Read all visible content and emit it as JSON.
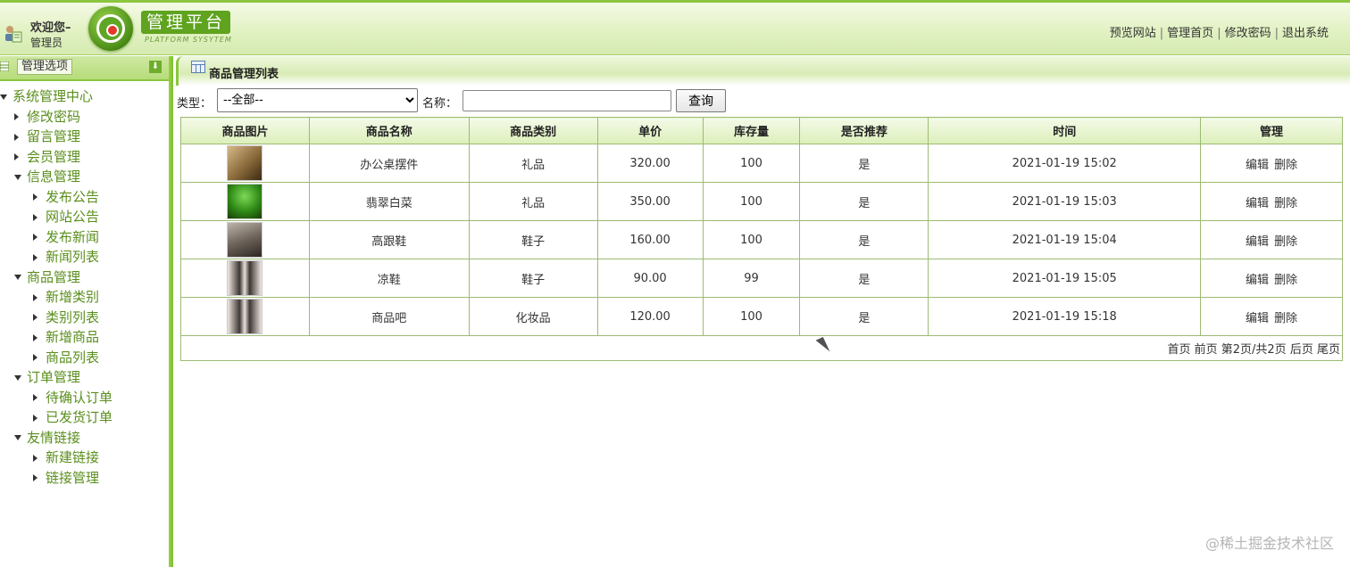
{
  "header": {
    "welcome": "欢迎您–",
    "role": "管理员",
    "logo_title": "管理平台",
    "logo_sub": "PLATFORM SYSYTEM",
    "links": [
      "预览网站",
      "管理首页",
      "修改密码",
      "退出系统"
    ],
    "accent": "#8cc63f"
  },
  "sidebar": {
    "title": "管理选项",
    "tree": [
      {
        "label": "系统管理中心",
        "level": 0,
        "icon": "triangle-down-icon"
      },
      {
        "label": "修改密码",
        "level": 1,
        "icon": "triangle-right-icon"
      },
      {
        "label": "留言管理",
        "level": 1,
        "icon": "triangle-right-icon"
      },
      {
        "label": "会员管理",
        "level": 1,
        "icon": "triangle-right-icon"
      },
      {
        "label": "信息管理",
        "level": 1,
        "icon": "triangle-down-icon"
      },
      {
        "label": "发布公告",
        "level": 2,
        "icon": "triangle-right-icon"
      },
      {
        "label": "网站公告",
        "level": 2,
        "icon": "triangle-right-icon"
      },
      {
        "label": "发布新闻",
        "level": 2,
        "icon": "triangle-right-icon"
      },
      {
        "label": "新闻列表",
        "level": 2,
        "icon": "triangle-right-icon"
      },
      {
        "label": "商品管理",
        "level": 1,
        "icon": "triangle-down-icon"
      },
      {
        "label": "新增类别",
        "level": 2,
        "icon": "triangle-right-icon"
      },
      {
        "label": "类别列表",
        "level": 2,
        "icon": "triangle-right-icon"
      },
      {
        "label": "新增商品",
        "level": 2,
        "icon": "triangle-right-icon"
      },
      {
        "label": "商品列表",
        "level": 2,
        "icon": "triangle-right-icon"
      },
      {
        "label": "订单管理",
        "level": 1,
        "icon": "triangle-down-icon"
      },
      {
        "label": "待确认订单",
        "level": 2,
        "icon": "triangle-right-icon"
      },
      {
        "label": "已发货订单",
        "level": 2,
        "icon": "triangle-right-icon"
      },
      {
        "label": "友情链接",
        "level": 1,
        "icon": "triangle-down-icon"
      },
      {
        "label": "新建链接",
        "level": 2,
        "icon": "triangle-right-icon"
      },
      {
        "label": "链接管理",
        "level": 2,
        "icon": "triangle-right-icon"
      }
    ]
  },
  "main": {
    "title": "商品管理列表",
    "search": {
      "type_label": "类型：",
      "type_selected": "--全部--",
      "name_label": "名称：",
      "name_value": "",
      "button": "查询"
    },
    "columns": [
      "商品图片",
      "商品名称",
      "商品类别",
      "单价",
      "库存量",
      "是否推荐",
      "时间",
      "管理"
    ],
    "rows": [
      {
        "name": "办公桌摆件",
        "category": "礼品",
        "price": "320.00",
        "stock": "100",
        "recommend": "是",
        "time": "2021-01-19 15:02",
        "edit": "编辑",
        "delete": "删除"
      },
      {
        "name": "翡翠白菜",
        "category": "礼品",
        "price": "350.00",
        "stock": "100",
        "recommend": "是",
        "time": "2021-01-19 15:03",
        "edit": "编辑",
        "delete": "删除"
      },
      {
        "name": "高跟鞋",
        "category": "鞋子",
        "price": "160.00",
        "stock": "100",
        "recommend": "是",
        "time": "2021-01-19 15:04",
        "edit": "编辑",
        "delete": "删除"
      },
      {
        "name": "凉鞋",
        "category": "鞋子",
        "price": "90.00",
        "stock": "99",
        "recommend": "是",
        "time": "2021-01-19 15:05",
        "edit": "编辑",
        "delete": "删除"
      },
      {
        "name": "商品吧",
        "category": "化妆品",
        "price": "120.00",
        "stock": "100",
        "recommend": "是",
        "time": "2021-01-19 15:18",
        "edit": "编辑",
        "delete": "删除"
      }
    ],
    "pager": {
      "first": "首页",
      "prev": "前页",
      "info": "第2页/共2页",
      "next": "后页",
      "last": "尾页"
    }
  },
  "watermark": "@稀土掘金技术社区"
}
